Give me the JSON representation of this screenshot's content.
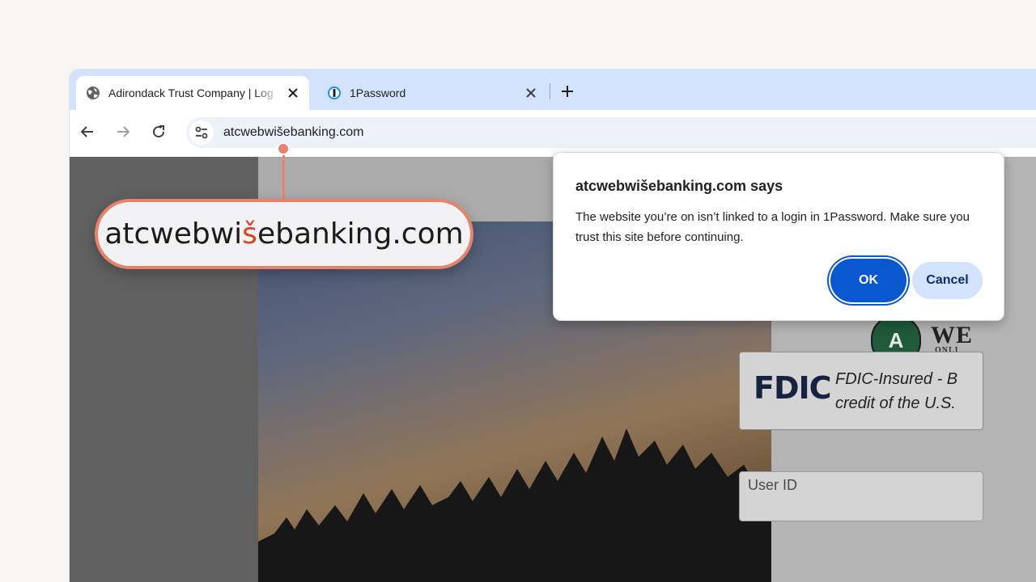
{
  "tabs": [
    {
      "title": "Adirondack Trust Company | Log",
      "icon": "globe-icon",
      "active": true
    },
    {
      "title": "1Password",
      "icon": "1password-icon",
      "active": false
    }
  ],
  "toolbar": {
    "url": "atcwebwišebanking.com",
    "back_icon": "arrow-left-icon",
    "forward_icon": "arrow-right-icon",
    "reload_icon": "reload-icon",
    "site_info_icon": "tune-icon"
  },
  "dialog": {
    "title": "atcwebwišebanking.com says",
    "message": "The website you’re on isn’t linked to a login in 1Password. Make sure you trust this site before continuing.",
    "ok_label": "OK",
    "cancel_label": "Cancel"
  },
  "callout": {
    "before": "atcwebwi",
    "highlight": "š",
    "after": "ebanking.com",
    "highlight_color": "#d7452b",
    "border_color": "#e8826d"
  },
  "page": {
    "logo_letter": "A",
    "logo_text": "WE",
    "logo_subtext": "ONLI",
    "fdic_logo": "FDIC",
    "fdic_line1": "FDIC-Insured - B",
    "fdic_line2": "credit of the U.S.",
    "userid_label": "User ID"
  },
  "colors": {
    "tabstrip": "#d3e3fd",
    "primary_button": "#0b57d0",
    "secondary_button": "#d3e3fd"
  }
}
